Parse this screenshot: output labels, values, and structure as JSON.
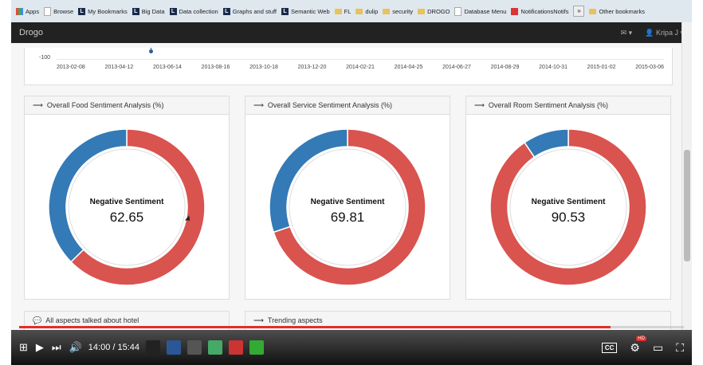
{
  "bookmarks": [
    "Apps",
    "Browse",
    "My Bookmarks",
    "Big Data",
    "Data collection",
    "Graphs and stuff",
    "Semantic Web",
    "FL",
    "dulip",
    "security",
    "DROGO",
    "Database Menu",
    "NotificationsNotifs",
    "Other bookmarks"
  ],
  "navbar": {
    "brand": "Drogo",
    "user": "Kripa J"
  },
  "timeline": {
    "ylabel": "-100",
    "ticks": [
      "2013-02-08",
      "2013-04-12",
      "2013-06-14",
      "2013-08-16",
      "2013-10-18",
      "2013-12-20",
      "2014-02-21",
      "2014-04-25",
      "2014-06-27",
      "2014-08-29",
      "2014-10-31",
      "2015-01-02",
      "2015-03-06"
    ]
  },
  "colors": {
    "negative": "#d9534f",
    "positive": "#337ab7",
    "navbar": "#222222",
    "progress": "#e52d27"
  },
  "chart_data": [
    {
      "type": "pie",
      "title": "Overall Food Sentiment Analysis (%)",
      "center_label": "Negative Sentiment",
      "center_value": "62.65",
      "slices": [
        {
          "value": 62.65,
          "color": "#d9534f"
        },
        {
          "value": 37.35,
          "color": "#337ab7"
        }
      ]
    },
    {
      "type": "pie",
      "title": "Overall Service Sentiment Analysis (%)",
      "center_label": "Negative Sentiment",
      "center_value": "69.81",
      "slices": [
        {
          "value": 69.81,
          "color": "#d9534f"
        },
        {
          "value": 30.19,
          "color": "#337ab7"
        }
      ]
    },
    {
      "type": "pie",
      "title": "Overall Room Sentiment Analysis (%)",
      "center_label": "Negative Sentiment",
      "center_value": "90.53",
      "slices": [
        {
          "value": 90.53,
          "color": "#d9534f"
        },
        {
          "value": 9.47,
          "color": "#337ab7"
        }
      ]
    }
  ],
  "bottom_panels": {
    "left": "All aspects talked about hotel",
    "right": "Trending aspects"
  },
  "player": {
    "time": "14:00 / 15:44",
    "progress": 0.8898,
    "cc_label": "CC",
    "hd_label": "HD"
  }
}
